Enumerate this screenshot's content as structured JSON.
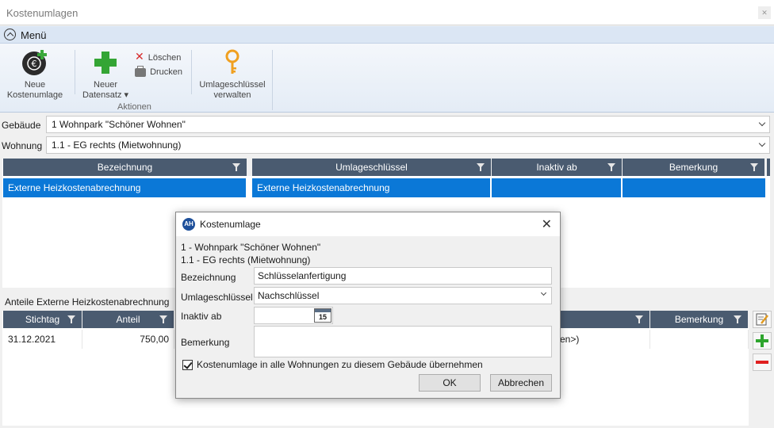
{
  "window": {
    "title": "Kostenumlagen"
  },
  "ribbon": {
    "menu_label": "Menü",
    "neue_kostenumlage": [
      "Neue",
      "Kostenumlage"
    ],
    "neuer_datensatz": [
      "Neuer",
      "Datensatz ▾"
    ],
    "loeschen": "Löschen",
    "drucken": "Drucken",
    "group_aktionen": "Aktionen",
    "umlageschluessel": [
      "Umlageschlüssel",
      "verwalten"
    ]
  },
  "filters": {
    "gebaeude_label": "Gebäude",
    "gebaeude_value": "1 Wohnpark \"Schöner Wohnen\"",
    "wohnung_label": "Wohnung",
    "wohnung_value": "1.1 - EG rechts (Mietwohnung)"
  },
  "main_grid": {
    "columns": [
      "Bezeichnung",
      "Umlageschlüssel",
      "Inaktiv ab",
      "Bemerkung"
    ],
    "rows": [
      {
        "bezeichnung": "Externe Heizkostenabrechnung",
        "umlageschluessel": "Externe Heizkostenabrechnung",
        "inaktiv_ab": "",
        "bemerkung": ""
      }
    ]
  },
  "anteile": {
    "title": "Anteile Externe Heizkostenabrechnung",
    "columns": [
      "Stichtag",
      "Anteil",
      "Bemerkung"
    ],
    "rows": [
      {
        "stichtag": "31.12.2021",
        "anteil": "750,00",
        "partial": "en>)"
      }
    ]
  },
  "dialog": {
    "title": "Kostenumlage",
    "icon_text": "AH",
    "line1": "1 - Wohnpark \"Schöner Wohnen\"",
    "line2": "1.1 - EG rechts (Mietwohnung)",
    "bezeichnung_label": "Bezeichnung",
    "bezeichnung_value": "Schlüsselanfertigung",
    "umlageschluessel_label": "Umlageschlüssel",
    "umlageschluessel_value": "Nachschlüssel",
    "inaktiv_label": "Inaktiv ab",
    "inaktiv_value": "",
    "calendar_day": "15",
    "bemerkung_label": "Bemerkung",
    "bemerkung_value": "",
    "checkbox_label": "Kostenumlage in alle Wohnungen zu diesem Gebäude übernehmen",
    "checkbox_checked": true,
    "ok": "OK",
    "cancel": "Abbrechen"
  },
  "colors": {
    "header": "#4a5b70",
    "selection": "#0b78d7",
    "ribbon": "#dbe6f4"
  }
}
